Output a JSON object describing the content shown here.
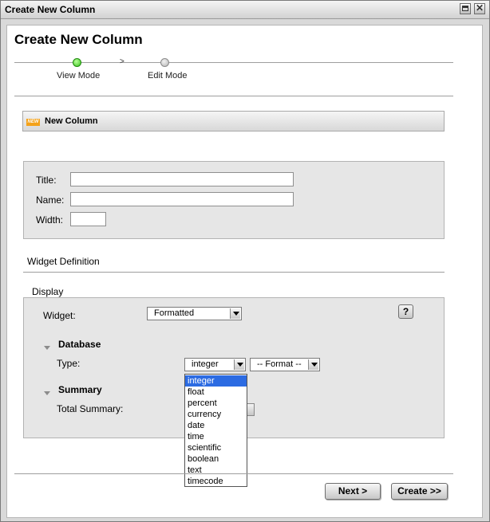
{
  "window": {
    "title": "Create New Column"
  },
  "page": {
    "title": "Create New Column"
  },
  "steps": [
    {
      "label": "View Mode",
      "state": "active"
    },
    {
      "label": "Edit Mode",
      "state": "inactive"
    }
  ],
  "step_arrow": ">",
  "new_column_section": {
    "badge": "NEW",
    "title": "New Column"
  },
  "form": {
    "title_label": "Title:",
    "title_value": "",
    "name_label": "Name:",
    "name_value": "",
    "width_label": "Width:",
    "width_value": ""
  },
  "widget_definition": {
    "heading": "Widget Definition",
    "display_heading": "Display",
    "widget_label": "Widget:",
    "widget_value": "Formatted",
    "help_label": "?"
  },
  "database": {
    "heading": "Database",
    "type_label": "Type:",
    "type_value": "integer",
    "format_value": "-- Format --",
    "type_options": [
      "integer",
      "float",
      "percent",
      "currency",
      "date",
      "time",
      "scientific",
      "boolean",
      "text",
      "timecode"
    ],
    "selected_option": "integer"
  },
  "summary": {
    "heading": "Summary",
    "total_label": "Total Summary:"
  },
  "buttons": {
    "next": "Next >",
    "create": "Create >>"
  },
  "colors": {
    "accent_selected": "#2c6be2",
    "step_active": "#37c21b"
  }
}
